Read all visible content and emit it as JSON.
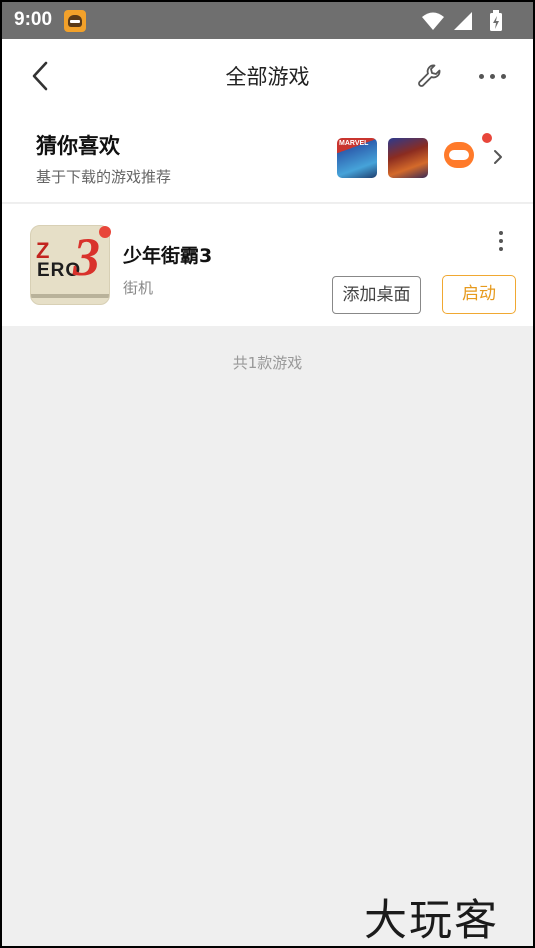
{
  "status_bar": {
    "time": "9:00",
    "icons": [
      "app-notification-icon",
      "wifi-icon",
      "signal-icon",
      "battery-charging-icon"
    ]
  },
  "header": {
    "title": "全部游戏",
    "back_icon": "chevron-left-icon",
    "wrench_icon": "wrench-icon",
    "more_icon": "more-horizontal-icon"
  },
  "recommendation": {
    "title": "猜你喜欢",
    "subtitle": "基于下载的游戏推荐",
    "thumbnails": [
      {
        "name": "game-thumbnail-marvel",
        "label": "MARVEL"
      },
      {
        "name": "game-thumbnail-fighter",
        "label": ""
      },
      {
        "name": "game-thumbnail-gamepad",
        "label": ""
      }
    ],
    "has_badge": true
  },
  "games": [
    {
      "name": "少年街霸3",
      "category": "街机",
      "add_button": "添加桌面",
      "start_button": "启动",
      "has_badge": true
    }
  ],
  "footer": {
    "count_text": "共1款游戏"
  },
  "watermark": "大玩客",
  "colors": {
    "status_bar": "#6f6f6f",
    "accent_orange": "#f0a832",
    "badge_red": "#e8463a",
    "background": "#efefef"
  }
}
